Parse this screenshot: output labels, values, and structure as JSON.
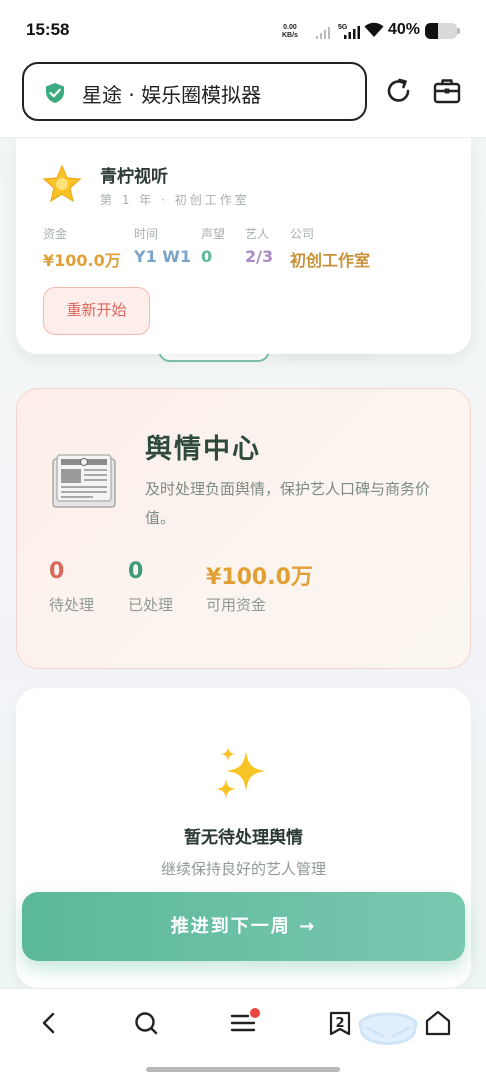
{
  "status_bar": {
    "time": "15:58",
    "net_speed_value": "0.00",
    "net_speed_unit": "KB/s",
    "network_label": "5G",
    "battery": "40%",
    "battery_level": 0.4
  },
  "browser": {
    "page_title": "星途 · 娱乐圈模拟器",
    "shield_color": "#3aaa7f"
  },
  "header": {
    "studio_name": "青柠视听",
    "studio_sub": "第 1 年 · 初创工作室",
    "stats": [
      {
        "label": "资金",
        "value": "¥100.0万",
        "color": "#e0a035"
      },
      {
        "label": "时间",
        "value": "Y1 W1",
        "color": "#7aa3c8"
      },
      {
        "label": "声望",
        "value": "0",
        "color": "#5cb89a"
      },
      {
        "label": "艺人",
        "value": "2/3",
        "color": "#a98bc4"
      },
      {
        "label": "公司",
        "value": "初创工作室",
        "color": "#c9923a"
      }
    ],
    "restart_label": "重新开始"
  },
  "pr_center": {
    "title": "舆情中心",
    "description": "及时处理负面舆情，保护艺人口碑与商务价值。",
    "stats": [
      {
        "value": "0",
        "label": "待处理",
        "color": "#d9685b"
      },
      {
        "value": "0",
        "label": "已处理",
        "color": "#3f9a78"
      },
      {
        "value": "¥100.0万",
        "label": "可用资金",
        "color": "#e0a035"
      }
    ]
  },
  "empty_state": {
    "title": "暂无待处理舆情",
    "subtitle": "继续保持良好的艺人管理"
  },
  "next_week_button": "推进到下一周 →",
  "bottom_nav": {
    "tab_count": "2"
  }
}
